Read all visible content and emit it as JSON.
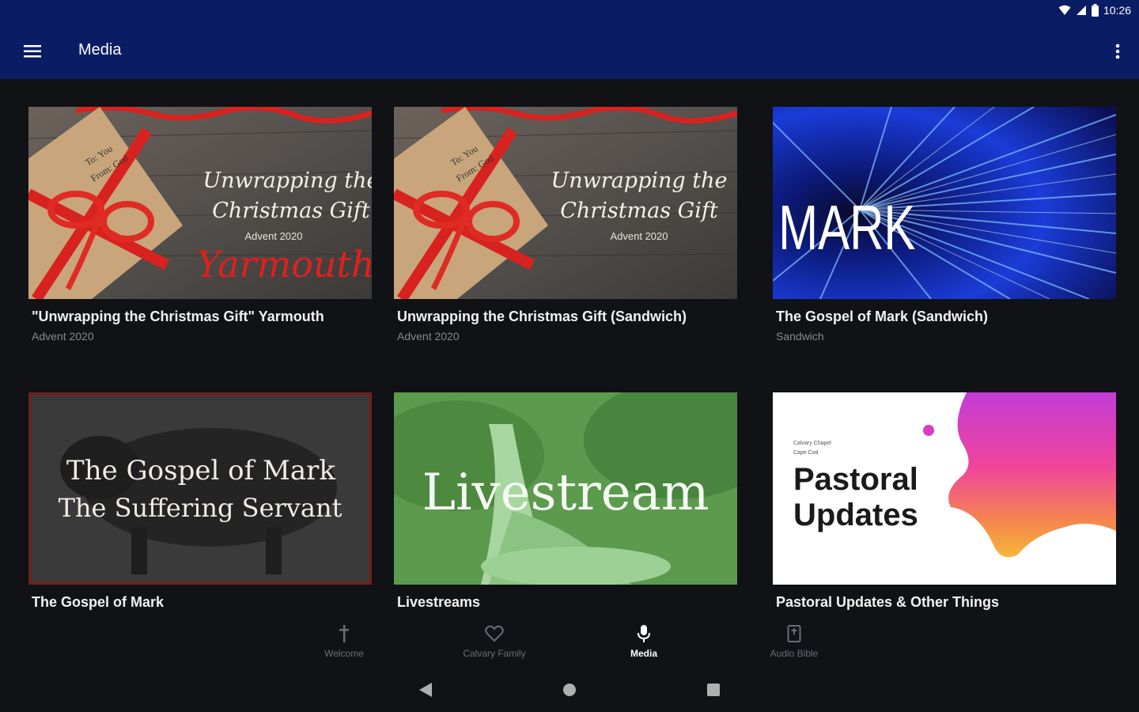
{
  "status_bar": {
    "time": "10:26"
  },
  "app_bar": {
    "title": "Media"
  },
  "cards": [
    {
      "title": "\"Unwrapping the Christmas Gift\" Yarmouth",
      "subtitle": "Advent 2020",
      "art": {
        "line1": "Unwrapping the",
        "line2": "Christmas Gift",
        "line3": "Advent 2020",
        "line4": "Yarmouth",
        "tag1": "To: You",
        "tag2": "From: God"
      }
    },
    {
      "title": "Unwrapping the Christmas Gift (Sandwich)",
      "subtitle": "Advent 2020",
      "art": {
        "line1": "Unwrapping the",
        "line2": "Christmas Gift",
        "line3": "Advent 2020",
        "tag1": "To: You",
        "tag2": "From: God"
      }
    },
    {
      "title": "The Gospel of Mark (Sandwich)",
      "subtitle": "Sandwich",
      "art": {
        "line1": "MARK"
      }
    },
    {
      "title": "The Gospel of Mark",
      "subtitle": "",
      "art": {
        "line1": "The Gospel of Mark",
        "line2": "The Suffering Servant"
      }
    },
    {
      "title": "Livestreams",
      "subtitle": "",
      "art": {
        "line1": "Livestream"
      }
    },
    {
      "title": "Pastoral Updates & Other Things",
      "subtitle": "",
      "art": {
        "line1": "Pastoral",
        "line2": "Updates",
        "small1": "Calvary Chapel",
        "small2": "Cape Cod"
      }
    }
  ],
  "bottom_nav": [
    {
      "label": "Welcome",
      "icon": "cross-icon"
    },
    {
      "label": "Calvary Family",
      "icon": "heart-icon"
    },
    {
      "label": "Media",
      "icon": "microphone-icon",
      "active": true
    },
    {
      "label": "Audio Bible",
      "icon": "book-icon"
    }
  ],
  "colors": {
    "app_bar": "#0a1c63",
    "background": "#111215",
    "accent_red": "#e0201e"
  }
}
